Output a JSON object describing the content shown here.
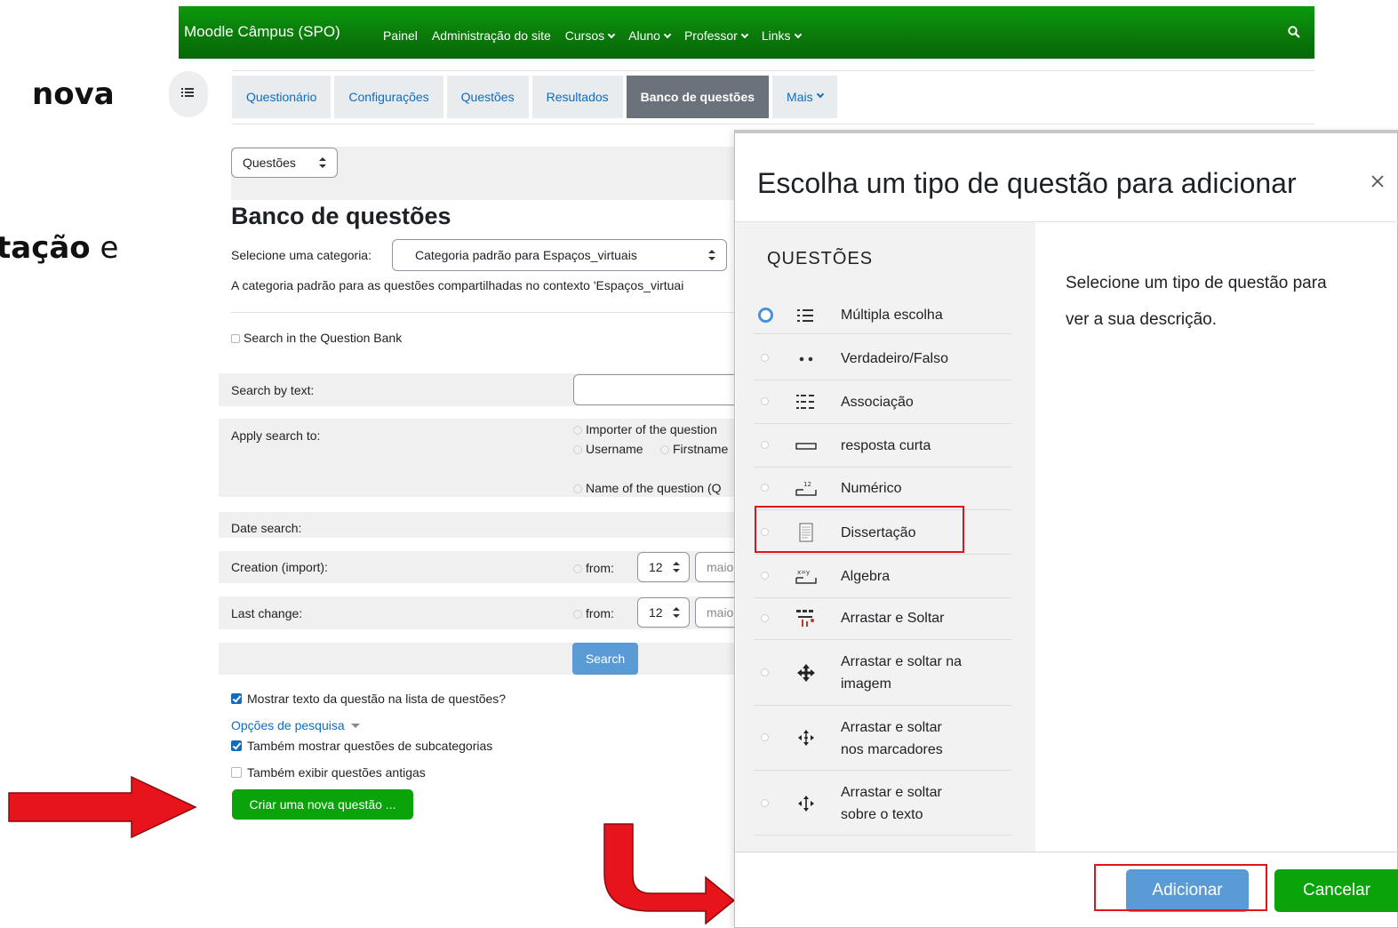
{
  "slide": {
    "text_nova": "nova",
    "text_tacao_bold": "tação",
    "text_tacao_rest": " e"
  },
  "navbar": {
    "brand": "Moodle Câmpus (SPO)",
    "links": [
      "Painel",
      "Administração do site",
      "Cursos",
      "Aluno",
      "Professor",
      "Links"
    ]
  },
  "tabs": [
    "Questionário",
    "Configurações",
    "Questões",
    "Resultados",
    "Banco de questões",
    "Mais"
  ],
  "bank": {
    "nav_select": "Questões",
    "title": "Banco de questões",
    "category_label": "Selecione uma categoria:",
    "category_value": "Categoria padrão para Espaços_virtuais",
    "category_info": "A categoria padrão para as questões compartilhadas no contexto 'Espaços_virtuai",
    "search_in_bank": "Search in the Question Bank",
    "search_by_text": "Search by text:",
    "apply_search_to": "Apply search to:",
    "apply_opt_importer": "Importer of the question",
    "apply_opt_username": "Username",
    "apply_opt_firstname": "Firstname",
    "apply_opt_name": "Name of the question (Q",
    "date_search": "Date search:",
    "creation": "Creation (import):",
    "last_change": "Last change:",
    "from": "from:",
    "day": "12",
    "month": "maio",
    "search_button": "Search",
    "show_text": "Mostrar texto da questão na lista de questões?",
    "search_options": "Opções de pesquisa",
    "show_sub": "Também mostrar questões de subcategorias",
    "show_old": "Também exibir questões antigas",
    "create_button": "Criar uma nova questão ..."
  },
  "modal": {
    "title": "Escolha um tipo de questão para adicionar",
    "section": "QUESTÕES",
    "items": [
      {
        "label": "Múltipla escolha"
      },
      {
        "label": "Verdadeiro/Falso"
      },
      {
        "label": "Associação"
      },
      {
        "label": "resposta curta"
      },
      {
        "label": "Numérico"
      },
      {
        "label": "Dissertação"
      },
      {
        "label": "Algebra"
      },
      {
        "label": "Arrastar e Soltar"
      },
      {
        "label_1": "Arrastar e soltar na",
        "label_2": "imagem"
      },
      {
        "label_1": "Arrastar e soltar",
        "label_2": "nos marcadores"
      },
      {
        "label_1": "Arrastar e soltar",
        "label_2": "sobre o texto"
      }
    ],
    "description_1": "Selecione um tipo de questão para",
    "description_2": "ver a sua descrição.",
    "add_button": "Adicionar",
    "cancel_button": "Cancelar"
  },
  "colors": {
    "navbar_green": "#0a7a0a",
    "link_blue": "#0f6cbf",
    "highlight_red": "#e0141b",
    "arrow_red": "#e8141b"
  }
}
